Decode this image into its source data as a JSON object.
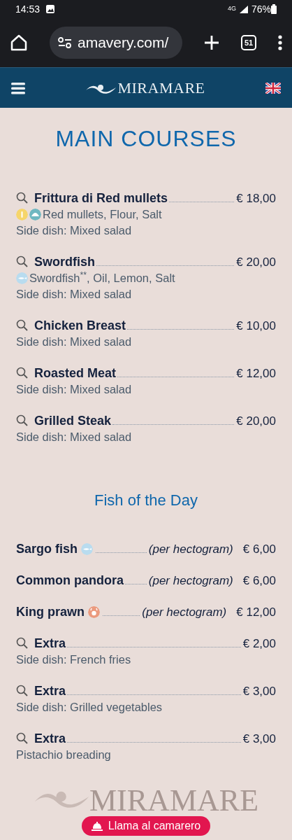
{
  "status_bar": {
    "time": "14:53",
    "network": "4G",
    "battery": "76%"
  },
  "browser": {
    "url": "amavery.com/",
    "tab_count": "51"
  },
  "header": {
    "brand": "MIRAMARE"
  },
  "sections": [
    {
      "title": "MAIN COURSES",
      "kind": "main",
      "items": [
        {
          "name": "Frittura di Red mullets",
          "price": "€ 18,00",
          "searchable": true,
          "allergens": [
            {
              "kind": "gluten"
            },
            {
              "kind": "mollusc"
            }
          ],
          "ingredients": "Red mullets, Flour, Salt",
          "side": "Side dish: Mixed salad"
        },
        {
          "name": "Swordfish",
          "price": "€ 20,00",
          "searchable": true,
          "allergens": [
            {
              "kind": "fish"
            }
          ],
          "ingredients": "Swordfish$^{**}$, Oil, Lemon, Salt",
          "side": "Side dish: Mixed salad"
        },
        {
          "name": "Chicken Breast",
          "price": "€ 10,00",
          "searchable": true,
          "side": "Side dish: Mixed salad"
        },
        {
          "name": "Roasted Meat",
          "price": "€ 12,00",
          "searchable": true,
          "side": "Side dish: Mixed salad"
        },
        {
          "name": "Grilled Steak",
          "price": "€ 20,00",
          "searchable": true,
          "side": "Side dish: Mixed salad"
        }
      ]
    },
    {
      "title": "Fish of the Day",
      "kind": "sub",
      "items": [
        {
          "name": "Sargo fish",
          "price": "€ 6,00",
          "searchable": false,
          "name_allergens": [
            {
              "kind": "fish"
            }
          ],
          "unit": "(per hectogram)"
        },
        {
          "name": "Common pandora",
          "price": "€ 6,00",
          "searchable": false,
          "unit": "(per hectogram)"
        },
        {
          "name": "King prawn",
          "price": "€ 12,00",
          "searchable": false,
          "name_allergens": [
            {
              "kind": "crustacean"
            }
          ],
          "unit": "(per hectogram)"
        },
        {
          "name": "Extra",
          "price": "€ 2,00",
          "searchable": true,
          "side": "Side dish: French fries"
        },
        {
          "name": "Extra",
          "price": "€ 3,00",
          "searchable": true,
          "side": "Side dish: Grilled vegetables"
        },
        {
          "name": "Extra",
          "price": "€ 3,00",
          "searchable": true,
          "side": "Pistachio breading"
        }
      ]
    }
  ],
  "footer": {
    "brand": "MIRAMARE",
    "call_button": "Llama al camarero"
  }
}
